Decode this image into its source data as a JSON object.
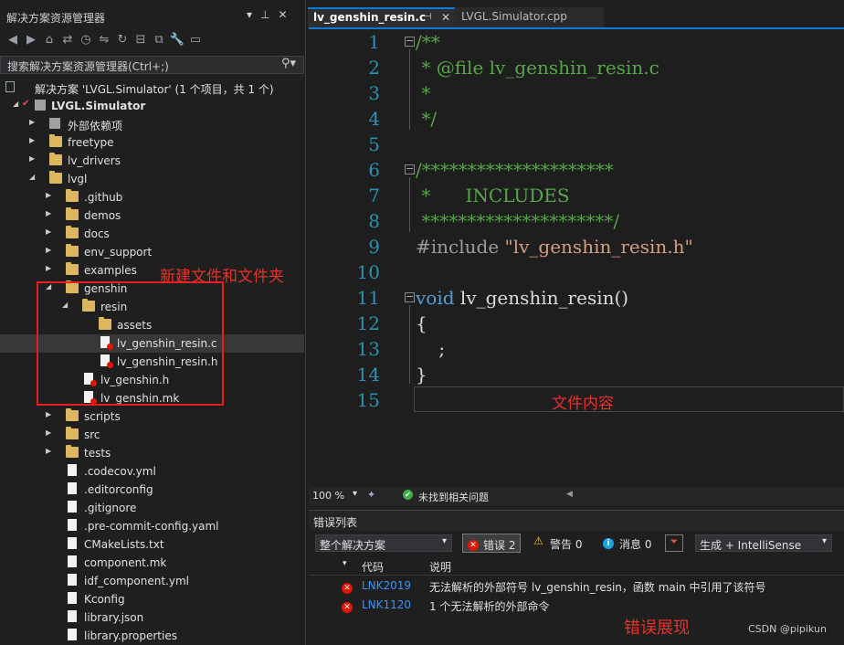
{
  "solution_explorer": {
    "title": "解决方案资源管理器",
    "search_placeholder": "搜索解决方案资源管理器(Ctrl+;)",
    "solution_label": "解决方案 'LVGL.Simulator' (1 个项目，共 1 个)",
    "project": "LVGL.Simulator",
    "items": [
      {
        "label": "外部依赖项"
      },
      {
        "label": "freetype"
      },
      {
        "label": "lv_drivers"
      },
      {
        "label": "lvgl"
      },
      {
        "label": ".github"
      },
      {
        "label": "demos"
      },
      {
        "label": "docs"
      },
      {
        "label": "env_support"
      },
      {
        "label": "examples"
      },
      {
        "label": "genshin"
      },
      {
        "label": "resin"
      },
      {
        "label": "assets"
      },
      {
        "label": "lv_genshin_resin.c"
      },
      {
        "label": "lv_genshin_resin.h"
      },
      {
        "label": "lv_genshin.h"
      },
      {
        "label": "lv_genshin.mk"
      },
      {
        "label": "scripts"
      },
      {
        "label": "src"
      },
      {
        "label": "tests"
      },
      {
        "label": ".codecov.yml"
      },
      {
        "label": ".editorconfig"
      },
      {
        "label": ".gitignore"
      },
      {
        "label": ".pre-commit-config.yaml"
      },
      {
        "label": "CMakeLists.txt"
      },
      {
        "label": "component.mk"
      },
      {
        "label": "idf_component.yml"
      },
      {
        "label": "Kconfig"
      },
      {
        "label": "library.json"
      },
      {
        "label": "library.properties"
      }
    ]
  },
  "annotations": {
    "new_files": "新建文件和文件夹",
    "file_content": "文件内容",
    "error_display": "错误展现"
  },
  "tabs": [
    {
      "label": "lv_genshin_resin.c",
      "active": true
    },
    {
      "label": "LVGL.Simulator.cpp",
      "active": false
    }
  ],
  "editor": {
    "line_numbers": [
      "1",
      "2",
      "3",
      "4",
      "5",
      "6",
      "7",
      "8",
      "9",
      "10",
      "11",
      "12",
      "13",
      "14",
      "15"
    ],
    "lines": {
      "l1": "/**",
      "l2": " * @file lv_genshin_resin.c",
      "l3": " *",
      "l4": " */",
      "l6": "/*********************",
      "l7": " *      INCLUDES",
      "l8": " *********************/",
      "l9_kw": "#include ",
      "l9_str": "\"lv_genshin_resin.h\"",
      "l11_kw": "void",
      "l11_rest": " lv_genshin_resin()",
      "l12": "{",
      "l13": "    ;",
      "l14": "}"
    }
  },
  "status_bar": {
    "zoom": "100 %",
    "issues": "未找到相关问题"
  },
  "error_list": {
    "title": "错误列表",
    "scope": "整个解决方案",
    "errors_label": "错误 2",
    "warnings_label": "警告 0",
    "messages_label": "消息 0",
    "build_filter": "生成 + IntelliSense",
    "col_code": "代码",
    "col_desc": "说明",
    "rows": [
      {
        "code": "LNK2019",
        "desc": "无法解析的外部符号 lv_genshin_resin，函数 main 中引用了该符号"
      },
      {
        "code": "LNK1120",
        "desc": "1 个无法解析的外部命令"
      }
    ]
  },
  "watermark": "CSDN @pipikun"
}
